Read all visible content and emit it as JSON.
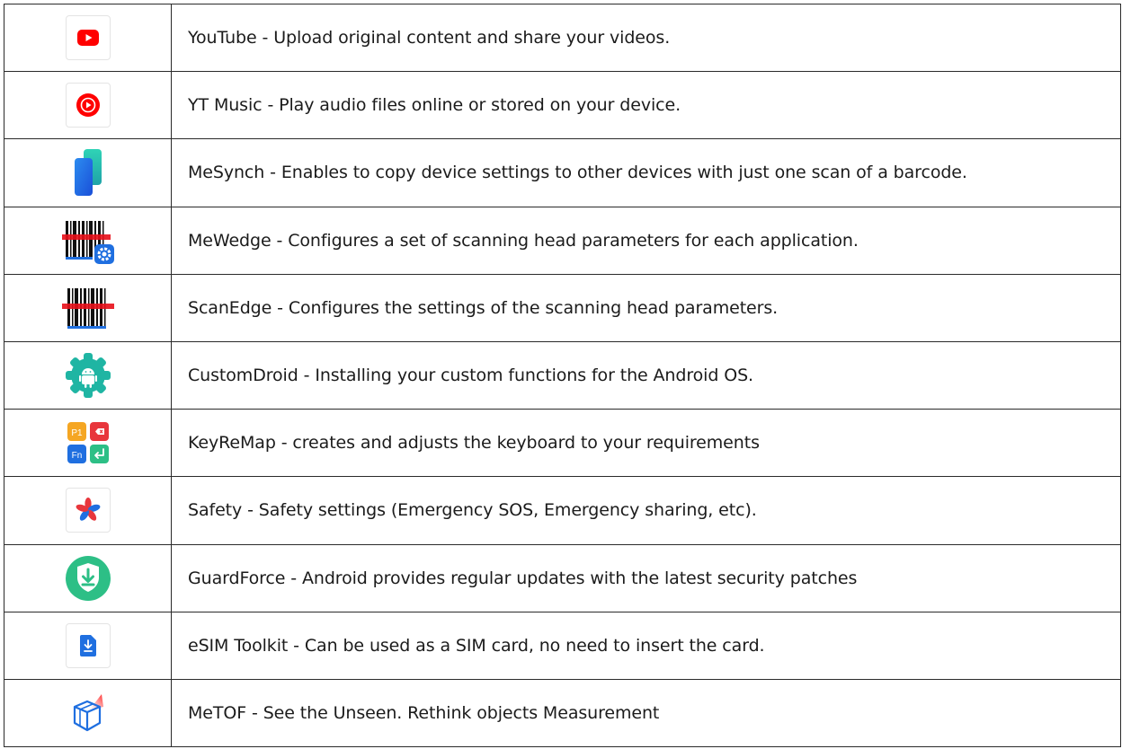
{
  "rows": [
    {
      "icon": "youtube-icon",
      "text": "YouTube - Upload original content and share your videos."
    },
    {
      "icon": "yt-music-icon",
      "text": "YT Music - Play audio files online or stored on your device."
    },
    {
      "icon": "mesynch-icon",
      "text": "MeSynch - Enables to copy device settings to other devices with just one scan of a barcode."
    },
    {
      "icon": "mewedge-icon",
      "text": "MeWedge - Configures a set of scanning head parameters for each application."
    },
    {
      "icon": "scanedge-icon",
      "text": "ScanEdge - Configures the settings of the scanning head parameters."
    },
    {
      "icon": "customdroid-icon",
      "text": "CustomDroid - Installing your custom functions for the Android OS."
    },
    {
      "icon": "keyremap-icon",
      "text": "KeyReMap - creates and adjusts the keyboard to your requirements",
      "keys": [
        "P1",
        "Fn"
      ]
    },
    {
      "icon": "safety-icon",
      "text": "Safety - Safety settings (Emergency SOS, Emergency sharing, etc)."
    },
    {
      "icon": "guardforce-icon",
      "text": "GuardForce - Android provides regular updates with the latest security patches"
    },
    {
      "icon": "esim-toolkit-icon",
      "text": "eSIM Toolkit - Can be used as a SIM card, no need to insert the card."
    },
    {
      "icon": "metof-icon",
      "text": "MeTOF - See the Unseen. Rethink objects Measurement"
    }
  ],
  "colors": {
    "youtube_red": "#ff0000",
    "blue": "#1f6fe0",
    "teal": "#1fb5a3",
    "green": "#2dbf86",
    "orange": "#f5a623"
  }
}
